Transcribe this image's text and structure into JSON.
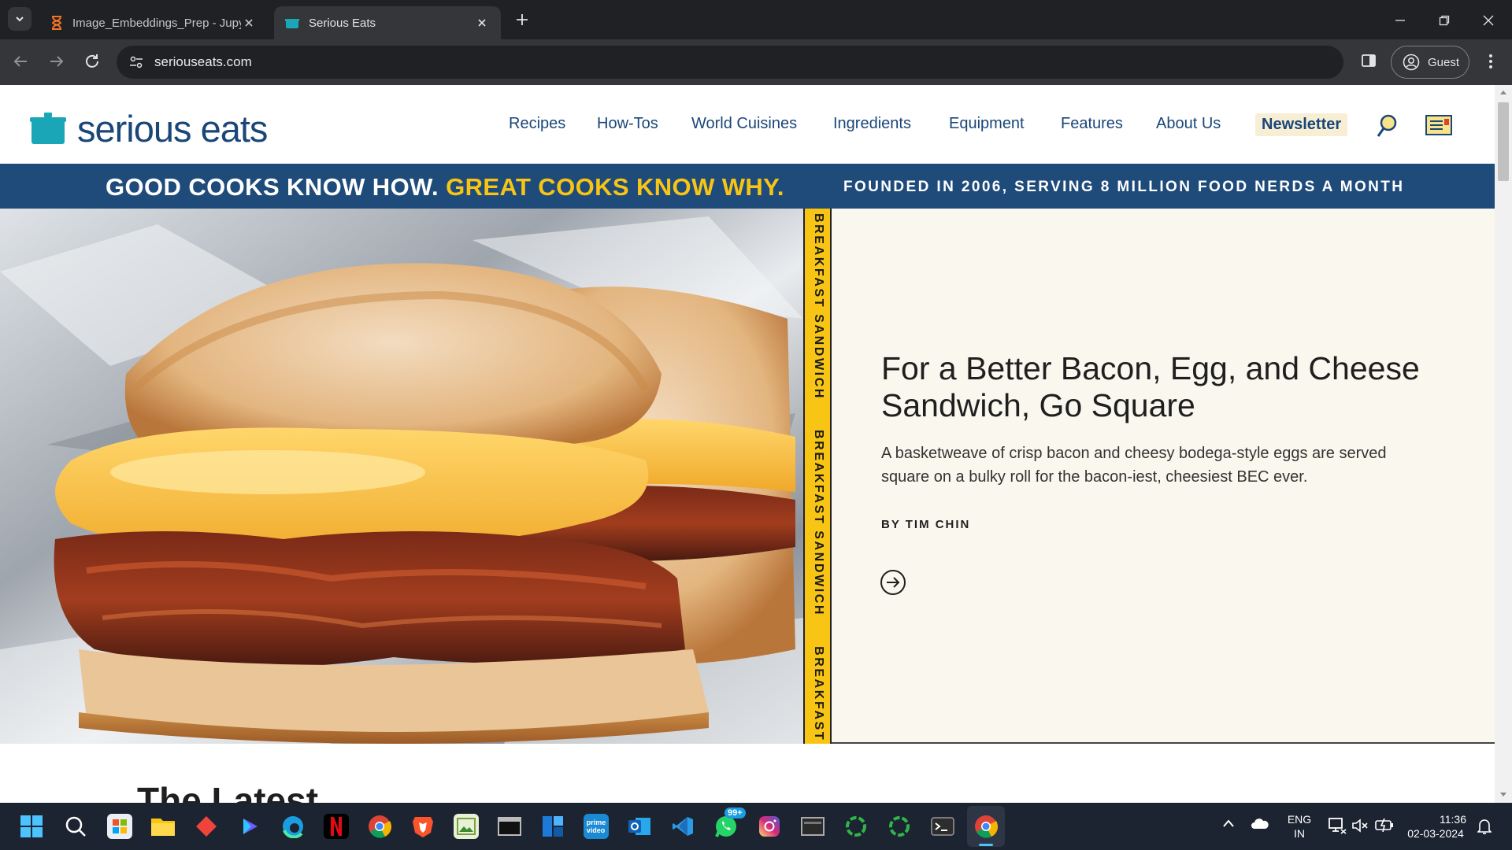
{
  "browser": {
    "tabs": [
      {
        "title": "Image_Embeddings_Prep - Jupyter",
        "active": false,
        "icon": "hourglass-icon"
      },
      {
        "title": "Serious Eats",
        "active": true,
        "icon": "serious-eats-pot-icon"
      }
    ],
    "url": "seriouseats.com",
    "profile_label": "Guest"
  },
  "site": {
    "logo_text": "serious eats",
    "nav": [
      "Recipes",
      "How-Tos",
      "World Cuisines",
      "Ingredients",
      "Equipment",
      "Features",
      "About Us"
    ],
    "newsletter": "Newsletter",
    "tagline_part1": "GOOD COOKS KNOW HOW.",
    "tagline_part2": "GREAT COOKS KNOW WHY.",
    "founded": "FOUNDED IN 2006, SERVING 8 MILLION FOOD NERDS A MONTH",
    "colors": {
      "brand_blue": "#1f4b7a",
      "accent_yellow": "#f8c514",
      "logo_teal": "#1aa6b7"
    }
  },
  "hero": {
    "category": "BREAKFAST SANDWICH",
    "headline": "For a Better Bacon, Egg, and Cheese Sandwich, Go Square",
    "description": "A basketweave of crisp bacon and cheesy bodega-style eggs are served square on a bulky roll for the bacon-iest, cheesiest BEC ever.",
    "byline": "BY TIM CHIN"
  },
  "section_heading": "The Latest",
  "taskbar": {
    "language": "ENG",
    "region": "IN",
    "time": "11:36",
    "date": "02-03-2024",
    "whatsapp_badge": "99+"
  }
}
